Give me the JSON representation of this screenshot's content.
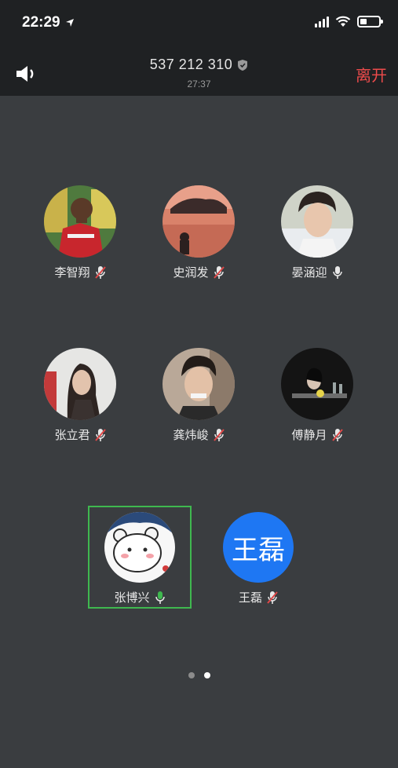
{
  "status_bar": {
    "time": "22:29"
  },
  "header": {
    "meeting_id": "537 212 310",
    "duration": "27:37",
    "leave_label": "离开"
  },
  "participants": [
    {
      "name": "李智翔",
      "mic": "muted"
    },
    {
      "name": "史润发",
      "mic": "muted"
    },
    {
      "name": "晏涵迎",
      "mic": "on"
    },
    {
      "name": "张立君",
      "mic": "muted"
    },
    {
      "name": "龚炜峻",
      "mic": "muted"
    },
    {
      "name": "傅静月",
      "mic": "muted"
    },
    {
      "name": "张博兴",
      "mic": "speaking"
    },
    {
      "name": "王磊",
      "mic": "muted",
      "avatar_text": "王磊"
    }
  ],
  "pager": {
    "pages": 2,
    "current": 2
  },
  "colors": {
    "accent_leave": "#ec4b4b",
    "speaking_green": "#3fb84f",
    "avatar_blue": "#1e77f3"
  }
}
